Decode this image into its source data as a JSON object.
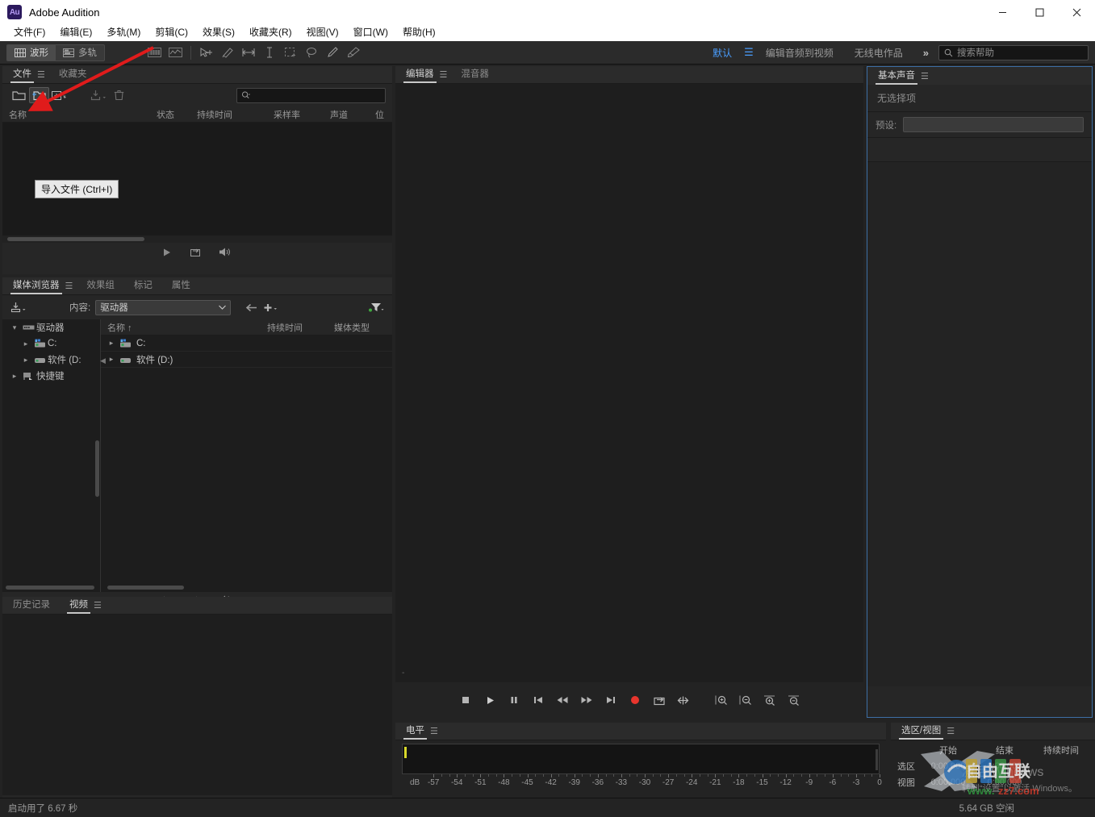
{
  "window": {
    "app_title": "Adobe Audition",
    "logo_text": "Au",
    "minimize_label": "—",
    "maximize_label": "□",
    "close_label": "✕"
  },
  "menubar": {
    "items": [
      {
        "label": "文件(F)",
        "name": "menu-file"
      },
      {
        "label": "编辑(E)",
        "name": "menu-edit"
      },
      {
        "label": "多轨(M)",
        "name": "menu-multitrack"
      },
      {
        "label": "剪辑(C)",
        "name": "menu-clip"
      },
      {
        "label": "效果(S)",
        "name": "menu-effects"
      },
      {
        "label": "收藏夹(R)",
        "name": "menu-favorites"
      },
      {
        "label": "视图(V)",
        "name": "menu-view"
      },
      {
        "label": "窗口(W)",
        "name": "menu-window"
      },
      {
        "label": "帮助(H)",
        "name": "menu-help"
      }
    ]
  },
  "toolbar": {
    "waveform_label": "波形",
    "multitrack_label": "多轨",
    "workspaces": [
      {
        "label": "默认",
        "active": true
      },
      {
        "label": "编辑音频到视频",
        "active": false
      },
      {
        "label": "无线电作品",
        "active": false
      }
    ],
    "overflow_label": "»",
    "search_placeholder": "搜索帮助"
  },
  "files_panel": {
    "tabs": [
      {
        "label": "文件",
        "active": true
      },
      {
        "label": "收藏夹",
        "active": false
      }
    ],
    "search_value": "",
    "columns": [
      "名称",
      "状态",
      "持续时间",
      "采样率",
      "声道",
      "位"
    ],
    "rows": [],
    "tooltip": "导入文件 (Ctrl+I)"
  },
  "media_panel": {
    "tabs": [
      {
        "label": "媒体浏览器",
        "active": true
      },
      {
        "label": "效果组",
        "active": false
      },
      {
        "label": "标记",
        "active": false
      },
      {
        "label": "属性",
        "active": false
      }
    ],
    "content_label": "内容:",
    "content_value": "驱动器",
    "tree": [
      {
        "label": "驱动器",
        "depth": 0,
        "expanded": true,
        "icon": "drives-icon"
      },
      {
        "label": "C:",
        "depth": 1,
        "expanded": false,
        "icon": "system-drive-icon"
      },
      {
        "label": "软件 (D:",
        "depth": 1,
        "expanded": false,
        "icon": "drive-icon"
      },
      {
        "label": "快捷键",
        "depth": 0,
        "expanded": false,
        "icon": "shortcut-icon"
      }
    ],
    "columns": [
      "名称 ↑",
      "持续时间",
      "媒体类型"
    ],
    "rows": [
      {
        "name": "C:",
        "icon": "system-drive-icon",
        "duration": "",
        "media_type": ""
      },
      {
        "name": "软件 (D:)",
        "icon": "drive-icon",
        "duration": "",
        "media_type": ""
      }
    ]
  },
  "history_panel": {
    "tabs": [
      {
        "label": "历史记录",
        "active": false
      },
      {
        "label": "视频",
        "active": true
      }
    ]
  },
  "editor_panel": {
    "tabs": [
      {
        "label": "编辑器",
        "active": true
      },
      {
        "label": "混音器",
        "active": false
      }
    ],
    "corner_mark": "-",
    "transport": [
      {
        "name": "stop-button",
        "glyph": "stop"
      },
      {
        "name": "play-button",
        "glyph": "play"
      },
      {
        "name": "pause-button",
        "glyph": "pause"
      },
      {
        "name": "move-to-start-button",
        "glyph": "to-start"
      },
      {
        "name": "rewind-button",
        "glyph": "rewind"
      },
      {
        "name": "fast-forward-button",
        "glyph": "forward"
      },
      {
        "name": "move-to-end-button",
        "glyph": "to-end"
      },
      {
        "name": "record-button",
        "glyph": "record"
      },
      {
        "name": "loop-playback-button",
        "glyph": "loop"
      },
      {
        "name": "skip-selection-button",
        "glyph": "skip-sel"
      },
      {
        "name": "zoom-in-amplitude-button",
        "glyph": "zoom-in-v"
      },
      {
        "name": "zoom-out-amplitude-button",
        "glyph": "zoom-out-v"
      },
      {
        "name": "zoom-in-time-button",
        "glyph": "zoom-in-h"
      },
      {
        "name": "zoom-out-time-button",
        "glyph": "zoom-out-h"
      }
    ]
  },
  "levels_panel": {
    "tabs": [
      {
        "label": "电平",
        "active": true
      }
    ],
    "unit_label": "dB",
    "ticks": [
      -57,
      -54,
      -51,
      -48,
      -45,
      -42,
      -39,
      -36,
      -33,
      -30,
      -27,
      -24,
      -21,
      -18,
      -15,
      -12,
      -9,
      -6,
      -3,
      0
    ],
    "scale_min": -60,
    "scale_max": 0
  },
  "essential_sound_panel": {
    "tabs": [
      {
        "label": "基本声音",
        "active": true
      }
    ],
    "no_selection": "无选择项",
    "preset_label": "预设:",
    "preset_value": ""
  },
  "selection_view_panel": {
    "tabs": [
      {
        "label": "选区/视图",
        "active": true
      }
    ],
    "columns": [
      "开始",
      "结束",
      "持续时间"
    ],
    "rows": [
      {
        "label": "选区",
        "start": "0:00.000",
        "end": "0:00.000",
        "duration": ""
      },
      {
        "label": "视图",
        "start": "0:00.000",
        "end": "0:00.000",
        "duration": ""
      }
    ]
  },
  "statusbar": {
    "startup_text": "启动用了 6.67 秒",
    "free_space": "5.64 GB 空闲"
  },
  "watermarks": {
    "activate_line1": "激活 Windows",
    "activate_line2": "转到“设置”以激活 Windows。",
    "site_text": "自由互联",
    "site_url": "www.zz7.com"
  },
  "colors": {
    "accent_blue": "#4a9eff",
    "panel_border_blue": "#3d6fa5",
    "record_red": "#e8352d",
    "annotation_red": "#e01b1b",
    "meter_yellow": "#d8d82a",
    "titlebar_bg": "#ffffff",
    "app_bg": "#232323"
  }
}
